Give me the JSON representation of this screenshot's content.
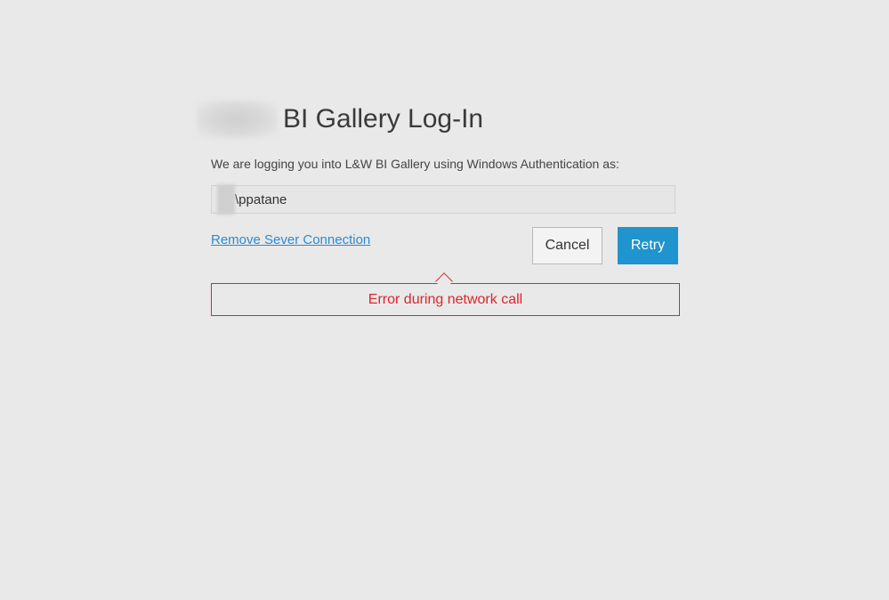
{
  "login": {
    "title": "BI Gallery Log-In",
    "subtitle": "We are logging you into L&W BI Gallery using Windows Authentication as:",
    "username": "\\ppatane",
    "remove_link": "Remove Sever Connection",
    "cancel_label": "Cancel",
    "retry_label": "Retry",
    "error_message": "Error during network call"
  },
  "colors": {
    "background": "#e9e9e9",
    "accent": "#1f94ce",
    "link": "#2b8bd1",
    "error": "#e0242d"
  }
}
